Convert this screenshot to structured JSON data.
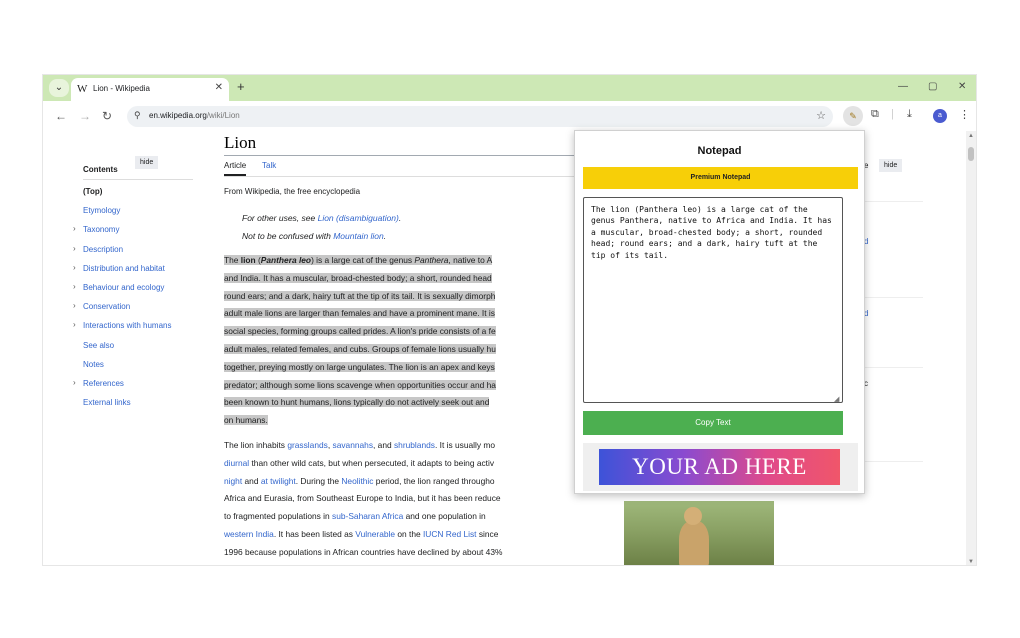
{
  "browser": {
    "tab_title": "Lion - Wikipedia",
    "tab_favicon": "W",
    "url_domain": "en.wikipedia.org",
    "url_path": "/wiki/Lion",
    "profile_initial": "a"
  },
  "wiki": {
    "contents_label": "Contents",
    "hide_label": "hide",
    "toc": [
      {
        "label": "(Top)",
        "chevron": false
      },
      {
        "label": "Etymology",
        "chevron": false
      },
      {
        "label": "Taxonomy",
        "chevron": true
      },
      {
        "label": "Description",
        "chevron": true
      },
      {
        "label": "Distribution and habitat",
        "chevron": true
      },
      {
        "label": "Behaviour and ecology",
        "chevron": true
      },
      {
        "label": "Conservation",
        "chevron": true
      },
      {
        "label": "Interactions with humans",
        "chevron": true
      },
      {
        "label": "See also",
        "chevron": false
      },
      {
        "label": "Notes",
        "chevron": false
      },
      {
        "label": "References",
        "chevron": true
      },
      {
        "label": "External links",
        "chevron": false
      }
    ],
    "title": "Lion",
    "tab_article": "Article",
    "tab_talk": "Talk",
    "tagline": "From Wikipedia, the free encyclopedia",
    "hatnote1_text": "For other uses, see ",
    "hatnote1_link": "Lion (disambiguation)",
    "hatnote1_end": ".",
    "hatnote2_text": "Not to be confused with ",
    "hatnote2_link": "Mountain lion",
    "hatnote2_end": ".",
    "para1": {
      "l1_a": "The ",
      "l1_b": "lion",
      "l1_c": " (",
      "l1_d": "Panthera leo",
      "l1_e": ") is a large cat of the genus ",
      "l1_f": "Panthera",
      "l1_g": ", native to A",
      "l2": "and India. It has a muscular, broad-chested body; a short, rounded head",
      "l3": "round ears; and a dark, hairy tuft at the tip of its tail. It is sexually dimorph",
      "l4": "adult male lions are larger than females and have a prominent mane. It is",
      "l5": "social species, forming groups called prides. A lion's pride consists of a fe",
      "l6": "adult males, related females, and cubs. Groups of female lions usually hu",
      "l7": "together, preying mostly on large ungulates. The lion is an apex and keys",
      "l8": "predator; although some lions scavenge when opportunities occur and ha",
      "l9": "been known to hunt humans, lions typically do not actively seek out and",
      "l10": "on humans."
    },
    "para2": {
      "l1_a": "The lion inhabits ",
      "l1_b": "grasslands",
      "l1_c": ", ",
      "l1_d": "savannahs",
      "l1_e": ", and ",
      "l1_f": "shrublands",
      "l1_g": ". It is usually mo",
      "l2_a": "diurnal",
      "l2_b": " than other wild cats, but when persecuted, it adapts to being activ",
      "l3_a": "night",
      "l3_b": " and ",
      "l3_c": "at twilight",
      "l3_d": ". During the ",
      "l3_e": "Neolithic",
      "l3_f": " period, the lion ranged througho",
      "l4": "Africa and Eurasia, from Southeast Europe to India, but it has been reduce",
      "l5_a": "to fragmented populations in ",
      "l5_b": "sub-Saharan Africa",
      "l5_c": " and one population in",
      "l6_a": "western India",
      "l6_b": ". It has been listed as ",
      "l6_c": "Vulnerable",
      "l6_d": " on the ",
      "l6_e": "IUCN Red List",
      "l6_f": " since",
      "l7": "1996 because populations in African countries have declined by about 43%"
    },
    "right_col": {
      "frag_e": "e",
      "frag_d1": "d",
      "frag_d2": "d",
      "frag_c": "c"
    }
  },
  "notepad": {
    "title": "Notepad",
    "premium_label": "Premium Notepad",
    "text": "The lion (Panthera leo) is a large cat of the genus Panthera, native to Africa and India. It has a muscular, broad-chested body; a short, rounded head; round ears; and a dark, hairy tuft at the tip of its tail.",
    "copy_label": "Copy Text",
    "ad_text": "YOUR AD HERE"
  },
  "colors": {
    "tabbar": "#cde8b5",
    "link": "#3366cc",
    "premium": "#f7cf08",
    "copy_button": "#4caf50",
    "highlight": "#c7c7c7"
  },
  "icons": [
    "tab-list-icon",
    "wikipedia-favicon-icon",
    "close-icon",
    "plus-icon",
    "minimize-icon",
    "maximize-icon",
    "back-arrow-icon",
    "forward-arrow-icon",
    "reload-icon",
    "site-info-icon",
    "star-icon",
    "notepad-extension-icon",
    "puzzle-extensions-icon",
    "download-icon",
    "kebab-menu-icon",
    "chevron-right-icon"
  ]
}
